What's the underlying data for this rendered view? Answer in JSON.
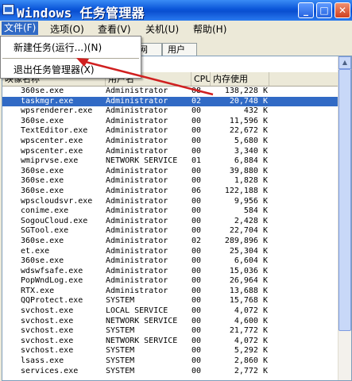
{
  "window": {
    "title": "Windows 任务管理器"
  },
  "titlebar": {
    "minimize": "_",
    "maximize": "□",
    "close": "✕"
  },
  "menu": [
    {
      "label": "文件(F)"
    },
    {
      "label": "选项(O)"
    },
    {
      "label": "查看(V)"
    },
    {
      "label": "关机(U)"
    },
    {
      "label": "帮助(H)"
    }
  ],
  "file_menu": {
    "new_task": "新建任务(运行...)(N)",
    "exit": "退出任务管理器(X)"
  },
  "tabs": [
    {
      "label": "网"
    },
    {
      "label": "用户"
    }
  ],
  "columns": {
    "name": "映像名称",
    "user": "用户名",
    "cpu": "CPU",
    "mem": "内存使用"
  },
  "processes": [
    {
      "name": "360se.exe",
      "user": "Administrator",
      "cpu": "08",
      "mem": "138,228 K"
    },
    {
      "name": "taskmgr.exe",
      "user": "Administrator",
      "cpu": "02",
      "mem": "20,748 K"
    },
    {
      "name": "wpsrenderer.exe",
      "user": "Administrator",
      "cpu": "00",
      "mem": "432 K"
    },
    {
      "name": "360se.exe",
      "user": "Administrator",
      "cpu": "00",
      "mem": "11,596 K"
    },
    {
      "name": "TextEditor.exe",
      "user": "Administrator",
      "cpu": "00",
      "mem": "22,672 K"
    },
    {
      "name": "wpscenter.exe",
      "user": "Administrator",
      "cpu": "00",
      "mem": "5,680 K"
    },
    {
      "name": "wpscenter.exe",
      "user": "Administrator",
      "cpu": "00",
      "mem": "3,340 K"
    },
    {
      "name": "wmiprvse.exe",
      "user": "NETWORK SERVICE",
      "cpu": "01",
      "mem": "6,884 K"
    },
    {
      "name": "360se.exe",
      "user": "Administrator",
      "cpu": "00",
      "mem": "39,880 K"
    },
    {
      "name": "360se.exe",
      "user": "Administrator",
      "cpu": "00",
      "mem": "1,828 K"
    },
    {
      "name": "360se.exe",
      "user": "Administrator",
      "cpu": "06",
      "mem": "122,188 K"
    },
    {
      "name": "wpscloudsvr.exe",
      "user": "Administrator",
      "cpu": "00",
      "mem": "9,956 K"
    },
    {
      "name": "conime.exe",
      "user": "Administrator",
      "cpu": "00",
      "mem": "584 K"
    },
    {
      "name": "SogouCloud.exe",
      "user": "Administrator",
      "cpu": "00",
      "mem": "2,428 K"
    },
    {
      "name": "SGTool.exe",
      "user": "Administrator",
      "cpu": "00",
      "mem": "22,704 K"
    },
    {
      "name": "360se.exe",
      "user": "Administrator",
      "cpu": "02",
      "mem": "289,896 K"
    },
    {
      "name": "et.exe",
      "user": "Administrator",
      "cpu": "00",
      "mem": "25,304 K"
    },
    {
      "name": "360se.exe",
      "user": "Administrator",
      "cpu": "00",
      "mem": "6,604 K"
    },
    {
      "name": "wdswfsafe.exe",
      "user": "Administrator",
      "cpu": "00",
      "mem": "15,036 K"
    },
    {
      "name": "PopWndLog.exe",
      "user": "Administrator",
      "cpu": "00",
      "mem": "26,964 K"
    },
    {
      "name": "RTX.exe",
      "user": "Administrator",
      "cpu": "00",
      "mem": "13,688 K"
    },
    {
      "name": "QQProtect.exe",
      "user": "SYSTEM",
      "cpu": "00",
      "mem": "15,768 K"
    },
    {
      "name": "svchost.exe",
      "user": "LOCAL SERVICE",
      "cpu": "00",
      "mem": "4,072 K"
    },
    {
      "name": "svchost.exe",
      "user": "NETWORK SERVICE",
      "cpu": "00",
      "mem": "4,600 K"
    },
    {
      "name": "svchost.exe",
      "user": "SYSTEM",
      "cpu": "00",
      "mem": "21,772 K"
    },
    {
      "name": "svchost.exe",
      "user": "NETWORK SERVICE",
      "cpu": "00",
      "mem": "4,072 K"
    },
    {
      "name": "svchost.exe",
      "user": "SYSTEM",
      "cpu": "00",
      "mem": "5,292 K"
    },
    {
      "name": "lsass.exe",
      "user": "SYSTEM",
      "cpu": "00",
      "mem": "2,860 K"
    },
    {
      "name": "services.exe",
      "user": "SYSTEM",
      "cpu": "00",
      "mem": "2,772 K"
    }
  ],
  "selected_row": 1,
  "colors": {
    "selection": "#316ac5",
    "annotation_arrow": "#d02020",
    "titlebar": "#0a55d8"
  },
  "icons": {
    "app": "taskmgr-icon",
    "scroll_up": "scroll-up-icon",
    "annotation": "red-arrow-icon"
  }
}
